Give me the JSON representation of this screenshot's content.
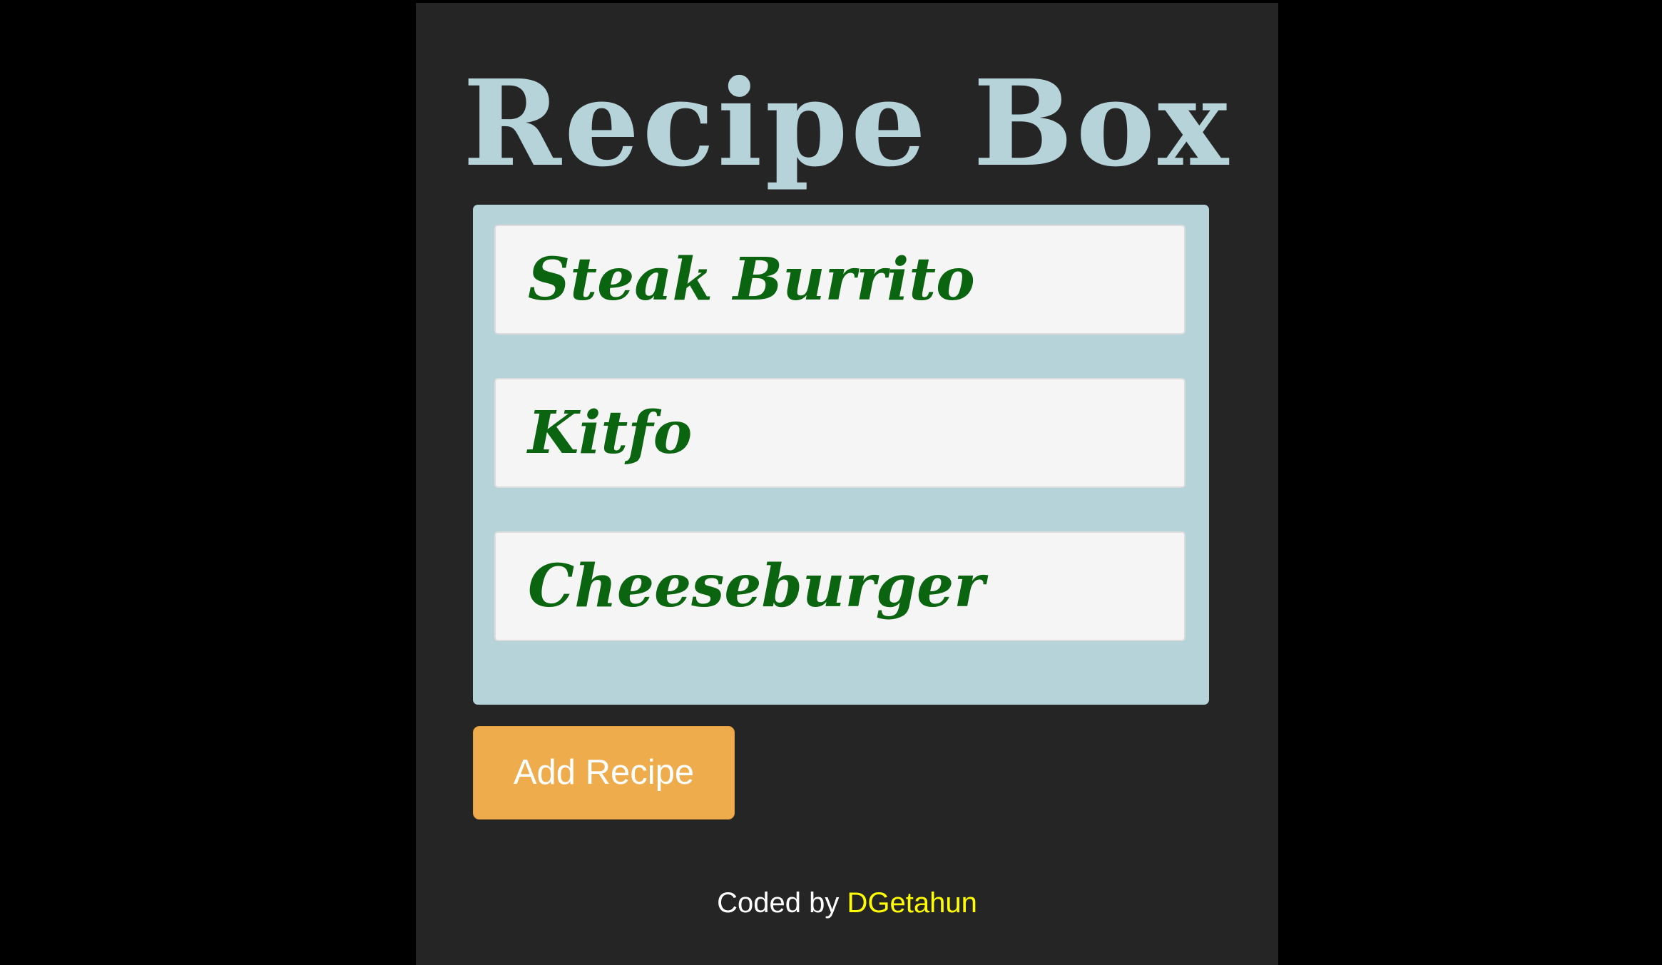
{
  "app": {
    "title": "Recipe Box"
  },
  "recipes": [
    {
      "name": "Steak Burrito"
    },
    {
      "name": "Kitfo"
    },
    {
      "name": "Cheeseburger"
    }
  ],
  "actions": {
    "add_label": "Add Recipe"
  },
  "footer": {
    "prefix": "Coded by",
    "author": "DGetahun"
  },
  "colors": {
    "page_background": "#000000",
    "app_background": "#252525",
    "accent": "#b5d3d9",
    "recipe_text": "#0b6410",
    "button": "#eeac4d",
    "author_link": "#ffff00"
  }
}
